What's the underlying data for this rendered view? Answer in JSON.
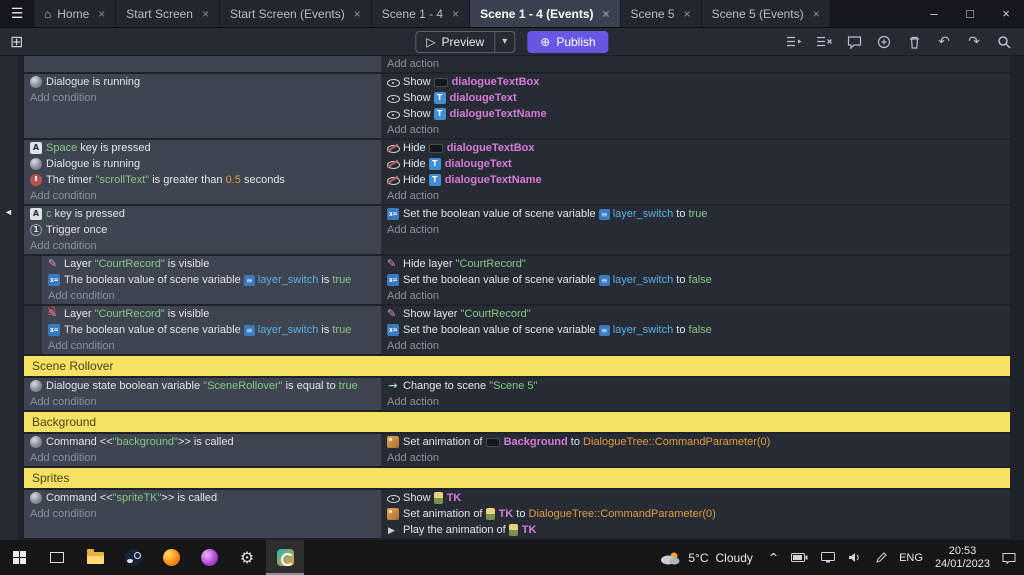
{
  "titlebar": {
    "tabs": [
      {
        "label": "Home",
        "icon": "home",
        "active": false
      },
      {
        "label": "Start Screen",
        "active": false
      },
      {
        "label": "Start Screen (Events)",
        "active": false
      },
      {
        "label": "Scene 1 - 4",
        "active": false
      },
      {
        "label": "Scene 1 - 4 (Events)",
        "active": true
      },
      {
        "label": "Scene 5",
        "active": false
      },
      {
        "label": "Scene 5 (Events)",
        "active": false
      }
    ]
  },
  "toolbar": {
    "preview_label": "Preview",
    "publish_label": "Publish"
  },
  "icons": {
    "menu": "☰",
    "home": "⌂",
    "close": "×",
    "minimize": "–",
    "maximize": "□",
    "grid": "⊞",
    "play_outline": "▷",
    "caret_down": "▾",
    "globe": "⊕",
    "undo": "↶",
    "redo": "↷",
    "fold_arrow": "◄",
    "chevron_up": "^",
    "gear": "⚙"
  },
  "colors": {
    "publish_accent": "#6857e5",
    "group_bar": "#f5e163",
    "condition_bg": "#3e4450",
    "action_bg": "#272c34",
    "object_text": "#d57bd8",
    "string_text": "#85c885",
    "number_text": "#e09a3e",
    "variable_text": "#58b0e8"
  },
  "events": [
    {
      "type": "event",
      "conditions": [],
      "actions": [
        [
          {
            "s": "Add action",
            "c": "add"
          }
        ]
      ]
    },
    {
      "type": "event",
      "conditions": [
        [
          {
            "i": "dialogue"
          },
          {
            "s": "Dialogue is running",
            "c": "p"
          }
        ],
        [
          {
            "s": "Add condition",
            "c": "add"
          }
        ]
      ],
      "actions": [
        [
          {
            "i": "visible"
          },
          {
            "s": "Show ",
            "c": "p"
          },
          {
            "i": "obj-box"
          },
          {
            "s": "dialogueTextBox",
            "c": "obj"
          }
        ],
        [
          {
            "i": "visible"
          },
          {
            "s": "Show ",
            "c": "p"
          },
          {
            "i": "obj-text"
          },
          {
            "s": "dialougeText",
            "c": "obj"
          }
        ],
        [
          {
            "i": "visible"
          },
          {
            "s": "Show ",
            "c": "p"
          },
          {
            "i": "obj-text"
          },
          {
            "s": "dialogueTextName",
            "c": "obj"
          }
        ],
        [
          {
            "s": "Add action",
            "c": "add"
          }
        ]
      ]
    },
    {
      "type": "event",
      "conditions": [
        [
          {
            "i": "keyboard"
          },
          {
            "s": "Space",
            "c": "str"
          },
          {
            "s": " key is pressed",
            "c": "p"
          }
        ],
        [
          {
            "i": "dialogue"
          },
          {
            "s": "Dialogue is running",
            "c": "p"
          }
        ],
        [
          {
            "i": "timer"
          },
          {
            "s": "The timer ",
            "c": "p"
          },
          {
            "s": "\"scrollText\"",
            "c": "str"
          },
          {
            "s": " is greater than ",
            "c": "p"
          },
          {
            "s": "0.5",
            "c": "num"
          },
          {
            "s": " seconds",
            "c": "p"
          }
        ],
        [
          {
            "s": "Add condition",
            "c": "add"
          }
        ]
      ],
      "actions": [
        [
          {
            "i": "hidden"
          },
          {
            "s": "Hide ",
            "c": "p"
          },
          {
            "i": "obj-box"
          },
          {
            "s": "dialogueTextBox",
            "c": "obj"
          }
        ],
        [
          {
            "i": "hidden"
          },
          {
            "s": "Hide ",
            "c": "p"
          },
          {
            "i": "obj-text"
          },
          {
            "s": "dialougeText",
            "c": "obj"
          }
        ],
        [
          {
            "i": "hidden"
          },
          {
            "s": "Hide ",
            "c": "p"
          },
          {
            "i": "obj-text"
          },
          {
            "s": "dialogueTextName",
            "c": "obj"
          }
        ],
        [
          {
            "s": "Add action",
            "c": "add"
          }
        ]
      ]
    },
    {
      "type": "event",
      "conditions": [
        [
          {
            "i": "keyboard"
          },
          {
            "s": "c",
            "c": "str"
          },
          {
            "s": " key is pressed",
            "c": "p"
          }
        ],
        [
          {
            "i": "trigger"
          },
          {
            "s": "Trigger once",
            "c": "p"
          }
        ],
        [
          {
            "s": "Add condition",
            "c": "add"
          }
        ]
      ],
      "actions": [
        [
          {
            "i": "varbool"
          },
          {
            "s": "Set the boolean value of scene variable ",
            "c": "p"
          },
          {
            "i": "varbadge"
          },
          {
            "s": "layer_switch",
            "c": "var"
          },
          {
            "s": " to ",
            "c": "p"
          },
          {
            "s": "true",
            "c": "str"
          }
        ],
        [
          {
            "s": "Add action",
            "c": "add"
          }
        ]
      ]
    },
    {
      "type": "event",
      "indent": 1,
      "conditions": [
        [
          {
            "i": "layer"
          },
          {
            "s": "Layer ",
            "c": "p"
          },
          {
            "s": "\"CourtRecord\"",
            "c": "str"
          },
          {
            "s": " is visible",
            "c": "p"
          }
        ],
        [
          {
            "i": "varbool"
          },
          {
            "s": "The boolean value of scene variable ",
            "c": "p"
          },
          {
            "i": "varbadge"
          },
          {
            "s": "layer_switch",
            "c": "var"
          },
          {
            "s": " is ",
            "c": "p"
          },
          {
            "s": "true",
            "c": "str"
          }
        ],
        [
          {
            "s": "Add condition",
            "c": "add"
          }
        ]
      ],
      "actions": [
        [
          {
            "i": "layer"
          },
          {
            "s": "Hide layer ",
            "c": "p"
          },
          {
            "s": "\"CourtRecord\"",
            "c": "str"
          }
        ],
        [
          {
            "i": "varbool"
          },
          {
            "s": "Set the boolean value of scene variable ",
            "c": "p"
          },
          {
            "i": "varbadge"
          },
          {
            "s": "layer_switch",
            "c": "var"
          },
          {
            "s": " to ",
            "c": "p"
          },
          {
            "s": "false",
            "c": "str"
          }
        ],
        [
          {
            "s": "Add action",
            "c": "add"
          }
        ]
      ]
    },
    {
      "type": "event",
      "indent": 1,
      "conditions": [
        [
          {
            "i": "layer-not"
          },
          {
            "s": "Layer ",
            "c": "p"
          },
          {
            "s": "\"CourtRecord\"",
            "c": "str"
          },
          {
            "s": " is visible",
            "c": "p"
          }
        ],
        [
          {
            "i": "varbool"
          },
          {
            "s": "The boolean value of scene variable ",
            "c": "p"
          },
          {
            "i": "varbadge"
          },
          {
            "s": "layer_switch",
            "c": "var"
          },
          {
            "s": " is ",
            "c": "p"
          },
          {
            "s": "true",
            "c": "str"
          }
        ],
        [
          {
            "s": "Add condition",
            "c": "add"
          }
        ]
      ],
      "actions": [
        [
          {
            "i": "layer"
          },
          {
            "s": "Show layer ",
            "c": "p"
          },
          {
            "s": "\"CourtRecord\"",
            "c": "str"
          }
        ],
        [
          {
            "i": "varbool"
          },
          {
            "s": "Set the boolean value of scene variable ",
            "c": "p"
          },
          {
            "i": "varbadge"
          },
          {
            "s": "layer_switch",
            "c": "var"
          },
          {
            "s": " to ",
            "c": "p"
          },
          {
            "s": "false",
            "c": "str"
          }
        ],
        [
          {
            "s": "Add action",
            "c": "add"
          }
        ]
      ]
    },
    {
      "type": "group",
      "label": "Scene Rollover"
    },
    {
      "type": "event",
      "conditions": [
        [
          {
            "i": "dialogue"
          },
          {
            "s": "Dialogue state boolean variable ",
            "c": "p"
          },
          {
            "s": "\"SceneRollover\"",
            "c": "str"
          },
          {
            "s": " is equal to ",
            "c": "p"
          },
          {
            "s": "true",
            "c": "str"
          }
        ],
        [
          {
            "s": "Add condition",
            "c": "add"
          }
        ]
      ],
      "actions": [
        [
          {
            "i": "scene"
          },
          {
            "s": "Change to scene ",
            "c": "p"
          },
          {
            "s": "\"Scene 5\"",
            "c": "str"
          }
        ],
        [
          {
            "s": "Add action",
            "c": "add"
          }
        ]
      ]
    },
    {
      "type": "group",
      "label": "Background"
    },
    {
      "type": "event",
      "conditions": [
        [
          {
            "i": "dialogue"
          },
          {
            "s": "Command <<",
            "c": "p"
          },
          {
            "s": "\"background\"",
            "c": "str"
          },
          {
            "s": ">> is called",
            "c": "p"
          }
        ],
        [
          {
            "s": "Add condition",
            "c": "add"
          }
        ]
      ],
      "actions": [
        [
          {
            "i": "animation"
          },
          {
            "s": "Set animation of ",
            "c": "p"
          },
          {
            "i": "obj-box"
          },
          {
            "s": "Background",
            "c": "obj"
          },
          {
            "s": " to ",
            "c": "p"
          },
          {
            "s": "DialogueTree::CommandParameter(0)",
            "c": "num"
          }
        ],
        [
          {
            "s": "Add action",
            "c": "add"
          }
        ]
      ]
    },
    {
      "type": "group",
      "label": "Sprites"
    },
    {
      "type": "event",
      "conditions": [
        [
          {
            "i": "dialogue"
          },
          {
            "s": "Command <<",
            "c": "p"
          },
          {
            "s": "\"spriteTK\"",
            "c": "str"
          },
          {
            "s": ">> is called",
            "c": "p"
          }
        ],
        [
          {
            "s": "Add condition",
            "c": "add"
          }
        ]
      ],
      "actions": [
        [
          {
            "i": "visible"
          },
          {
            "s": "Show ",
            "c": "p"
          },
          {
            "i": "obj-tk"
          },
          {
            "s": "TK",
            "c": "obj"
          }
        ],
        [
          {
            "i": "animation"
          },
          {
            "s": "Set animation of ",
            "c": "p"
          },
          {
            "i": "obj-tk"
          },
          {
            "s": "TK",
            "c": "obj"
          },
          {
            "s": " to ",
            "c": "p"
          },
          {
            "s": "DialogueTree::CommandParameter(0)",
            "c": "num"
          }
        ],
        [
          {
            "i": "play"
          },
          {
            "s": "Play the animation of ",
            "c": "p"
          },
          {
            "i": "obj-tk"
          },
          {
            "s": "TK",
            "c": "obj"
          }
        ]
      ]
    }
  ],
  "taskbar": {
    "weather": {
      "temp": "5°C",
      "desc": "Cloudy"
    },
    "language": "ENG",
    "time": "20:53",
    "date": "24/01/2023"
  }
}
